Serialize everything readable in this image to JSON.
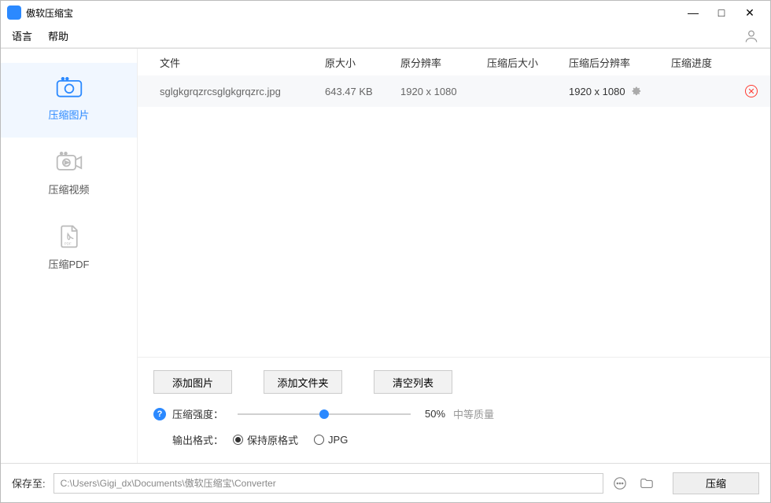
{
  "title": "傲软压缩宝",
  "menu": {
    "language": "语言",
    "help": "帮助"
  },
  "window": {
    "min": "—",
    "max": "□",
    "close": "✕"
  },
  "sidebar": {
    "image": "压缩图片",
    "video": "压缩视频",
    "pdf": "压缩PDF"
  },
  "table": {
    "headers": {
      "file": "文件",
      "orig_size": "原大小",
      "orig_res": "原分辨率",
      "comp_size": "压缩后大小",
      "comp_res": "压缩后分辨率",
      "progress": "压缩进度"
    },
    "row": {
      "file": "sglgkgrqzrcsglgkgrqzrc.jpg",
      "orig_size": "643.47 KB",
      "orig_res": "1920 x 1080",
      "comp_size": "",
      "comp_res": "1920 x 1080",
      "progress": ""
    }
  },
  "buttons": {
    "add_image": "添加图片",
    "add_folder": "添加文件夹",
    "clear": "清空列表"
  },
  "slider": {
    "label": "压缩强度：",
    "value": "50%",
    "quality": "中等质量"
  },
  "output_format": {
    "label": "输出格式：",
    "keep": "保持原格式",
    "jpg": "JPG"
  },
  "footer": {
    "save_to": "保存至:",
    "path": "C:\\Users\\Gigi_dx\\Documents\\傲软压缩宝\\Converter",
    "compress": "压缩"
  }
}
